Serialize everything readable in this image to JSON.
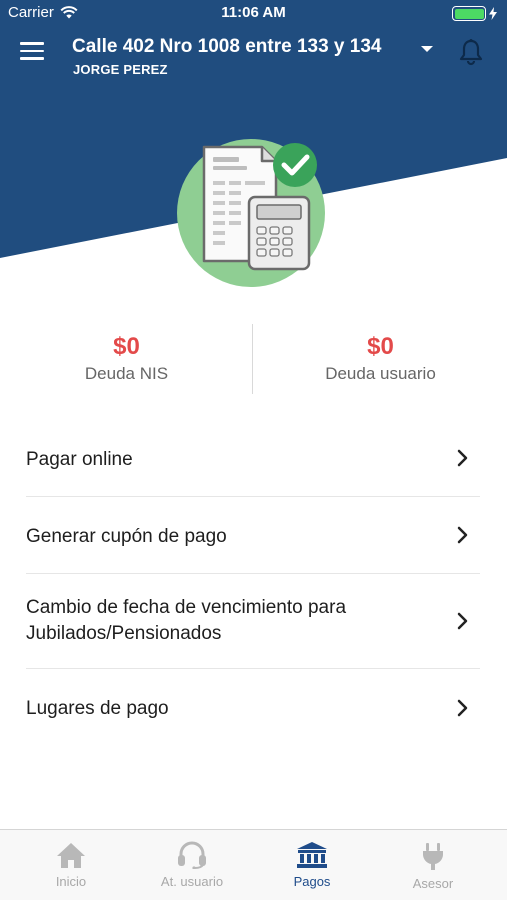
{
  "status_bar": {
    "carrier": "Carrier",
    "time": "11:06 AM"
  },
  "header": {
    "address": "Calle 402 Nro 1008 entre 133 y 134",
    "user_name": "JORGE PEREZ"
  },
  "debts": [
    {
      "amount": "$0",
      "label": "Deuda NIS"
    },
    {
      "amount": "$0",
      "label": "Deuda usuario"
    }
  ],
  "menu": {
    "items": [
      {
        "label": "Pagar online"
      },
      {
        "label": "Generar cupón de pago"
      },
      {
        "label": "Cambio de fecha de vencimiento para Jubilados/Pensionados"
      },
      {
        "label": "Lugares de pago"
      }
    ]
  },
  "tabs": [
    {
      "label": "Inicio",
      "icon": "home-icon"
    },
    {
      "label": "At. usuario",
      "icon": "headset-icon"
    },
    {
      "label": "Pagos",
      "icon": "bank-icon",
      "active": true
    },
    {
      "label": "Asesor",
      "icon": "plug-icon"
    }
  ],
  "colors": {
    "header_blue": "#204d7f",
    "debt_red": "#e34a4a",
    "hero_green": "#8fce93",
    "check_green": "#3aa35a",
    "active_tab": "#1f4c8a",
    "inactive_tab": "#a8a8a8"
  }
}
